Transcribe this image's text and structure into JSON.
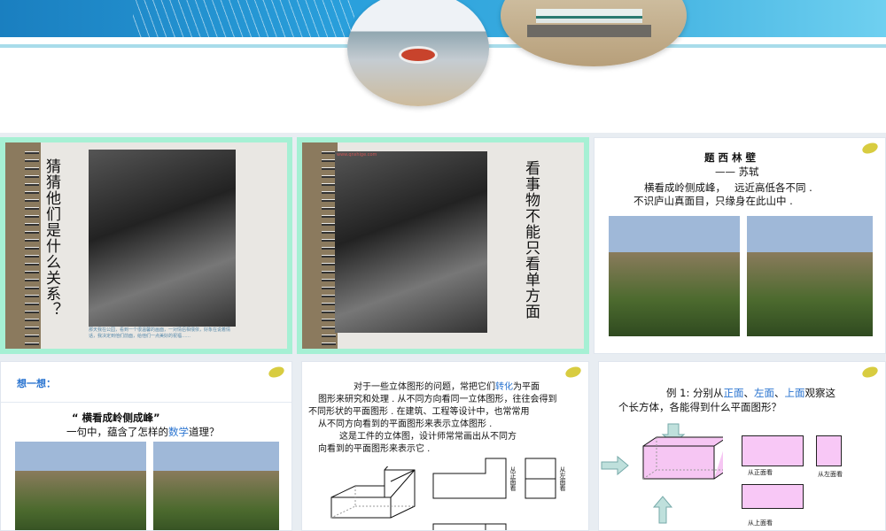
{
  "slides": [
    {
      "id": 1,
      "type": "title-image"
    },
    {
      "id": 2,
      "vertical_text": "猜猜他们是什么关系？",
      "caption": "那天我在公园，看到一个很温馨的画面，一对情侣相偎依，好象在说着情话，我决定到他们前面，给他们一点美好的祝福……"
    },
    {
      "id": 3,
      "vertical_text": "看事物不能只看单方面",
      "watermark": "www.qnshige.com"
    },
    {
      "id": 4,
      "title": "题 西 林 壁",
      "author": "—— 苏轼",
      "line1": "横看成岭侧成峰，",
      "line1b": "远近高低各不同 .",
      "line2": "不识庐山真面目，只缘身在此山中 ."
    },
    {
      "id": 5,
      "heading": "想一想：",
      "quote": "“ 横看成岭侧成峰”",
      "question_a": "一句中，蕴含了怎样的",
      "question_hl": "数学",
      "question_b": "道理？"
    },
    {
      "id": 6,
      "p1a": "对于一些立体图形的问题，常把它们",
      "p1hl": "转化",
      "p1b": "为平面",
      "p2": "图形来研究和处理 . 从不同方向看同一立体图形，往往会得到",
      "p3": "不同形状的平面图形 . 在建筑、工程等设计中，也常常用",
      "p4": "从不同方向看到的平面图形来表示立体图形 .",
      "p5": "这是工件的立体图，设计师常常画出从不同方",
      "p6": "向看到的平面图形来表示它 .",
      "view_front": "从正面看",
      "view_left": "从左面看"
    },
    {
      "id": 7,
      "ex_a": "例 1: 分别从",
      "ex_front": "正面",
      "sep1": "、",
      "ex_left": "左面",
      "sep2": "、",
      "ex_top": "上面",
      "ex_b": "观察这",
      "ex_line2": "个长方体，各能得到什么平面图形？",
      "label_front": "从正面看",
      "label_left": "从左面看",
      "label_top": "从上面看"
    }
  ]
}
